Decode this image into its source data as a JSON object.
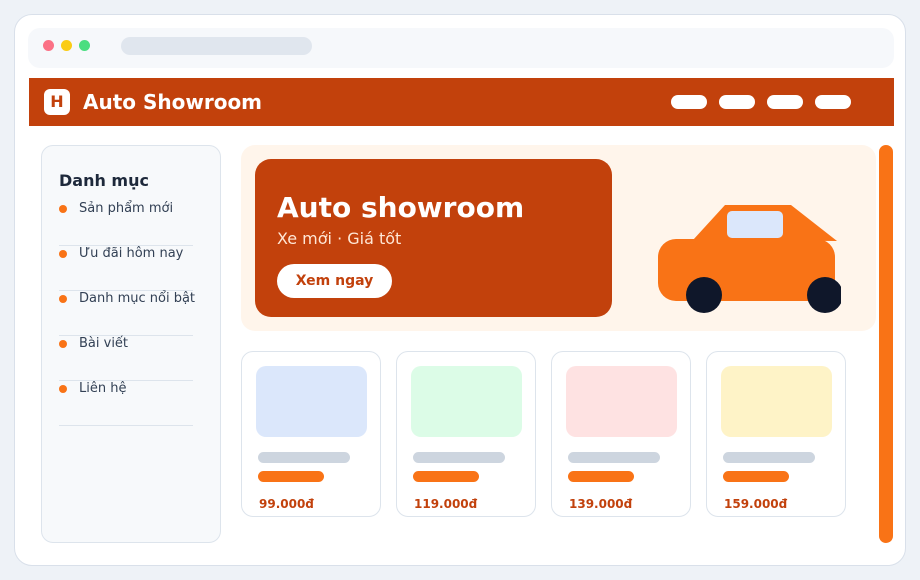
{
  "colors": {
    "brand": "#c2410c",
    "accent": "#f97316",
    "hero_background": "#fff5eb",
    "dot_red": "#fb7185",
    "dot_yellow": "#facc15",
    "dot_green": "#4ade80",
    "car_body": "#f97316",
    "car_window": "#dbe7fb",
    "car_wheel": "#0f172a"
  },
  "header": {
    "logo_letter": "H",
    "title": "Auto Showroom",
    "nav_items": [
      "",
      "",
      "",
      ""
    ]
  },
  "sidebar": {
    "title": "Danh mục",
    "items": [
      {
        "label": "Sản phẩm mới"
      },
      {
        "label": "Ưu đãi hôm nay"
      },
      {
        "label": "Danh mục nổi bật"
      },
      {
        "label": "Bài viết"
      },
      {
        "label": "Liên hệ"
      }
    ]
  },
  "hero": {
    "title": "Auto showroom",
    "subtitle": "Xe mới · Giá tốt",
    "cta_label": "Xem ngay",
    "illustration_icon": "car-icon"
  },
  "products": [
    {
      "price": "99.000đ",
      "thumb_color": "#dbe7fb"
    },
    {
      "price": "119.000đ",
      "thumb_color": "#dcfce7"
    },
    {
      "price": "139.000đ",
      "thumb_color": "#fee2e2"
    },
    {
      "price": "159.000đ",
      "thumb_color": "#fef3c7"
    }
  ]
}
